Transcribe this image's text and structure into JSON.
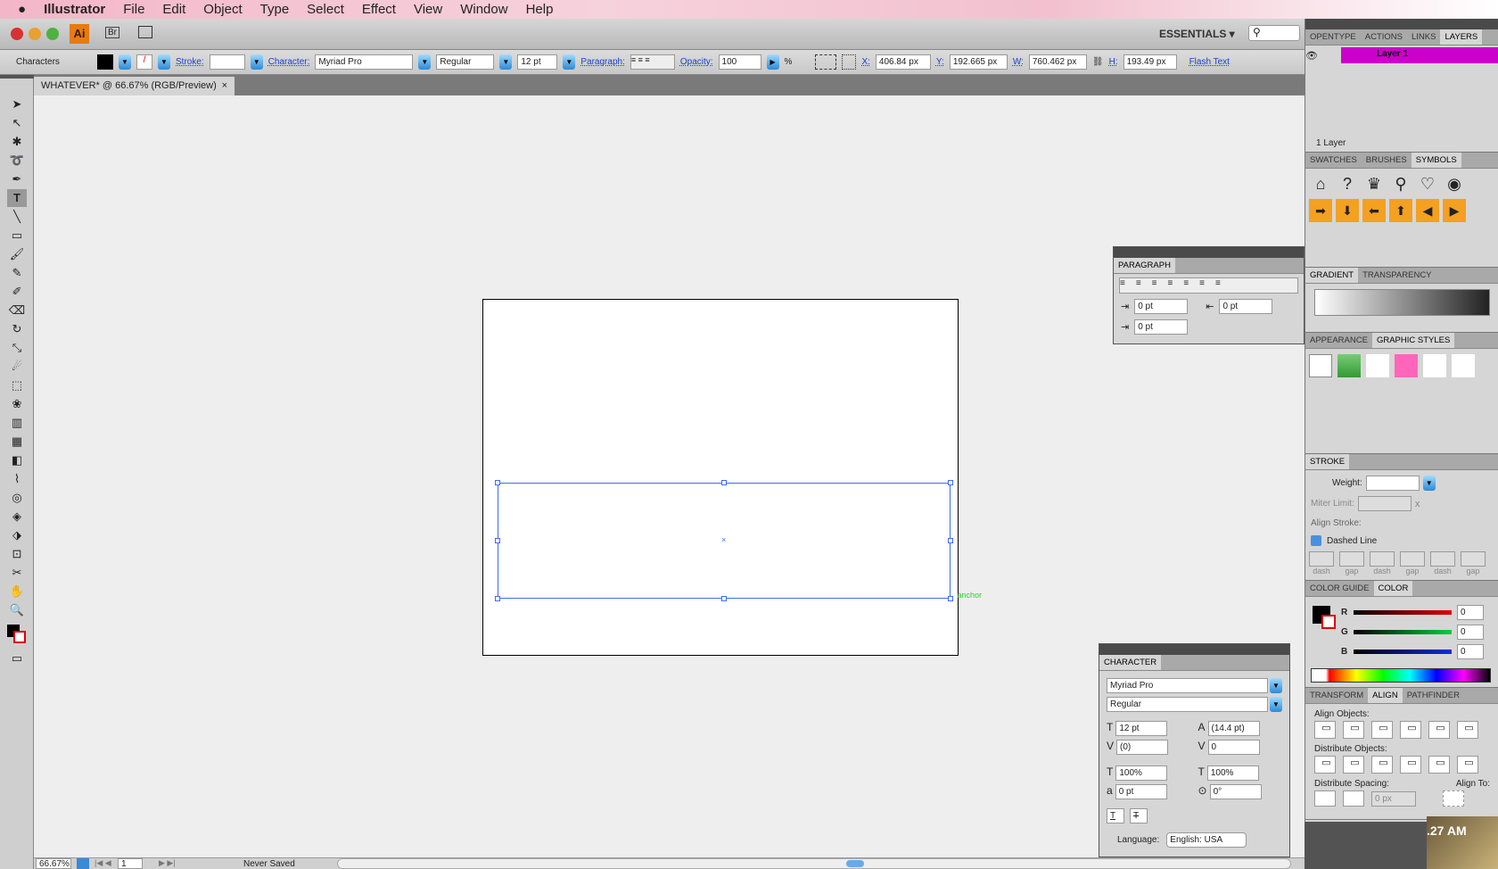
{
  "menubar": {
    "app": "Illustrator",
    "items": [
      "File",
      "Edit",
      "Object",
      "Type",
      "Select",
      "Effect",
      "View",
      "Window",
      "Help"
    ]
  },
  "appbar": {
    "logo": "Ai",
    "bridge": "Br",
    "workspace": "ESSENTIALS ▾"
  },
  "control": {
    "mode": "Characters",
    "stroke_label": "Stroke:",
    "character_label": "Character:",
    "font": "Myriad Pro",
    "style": "Regular",
    "size": "12 pt",
    "paragraph_label": "Paragraph:",
    "opacity_label": "Opacity:",
    "opacity": "100",
    "pct": "%",
    "x_label": "X:",
    "x": "406.84 px",
    "y_label": "Y:",
    "y": "192.665 px",
    "w_label": "W:",
    "w": "760.462 px",
    "h_label": "H:",
    "h": "193.49 px",
    "flash": "Flash Text"
  },
  "document": {
    "tab": "WHATEVER* @ 66.67% (RGB/Preview)",
    "close": "×",
    "anchor_hint": "anchor"
  },
  "status": {
    "zoom": "66.67%",
    "page": "1",
    "saved": "Never Saved"
  },
  "layers": {
    "tabs": [
      "OPENTYPE",
      "ACTIONS",
      "LINKS",
      "LAYERS"
    ],
    "layer": "Layer 1",
    "count": "1 Layer",
    "layer_color": "#cc00cc"
  },
  "symbols": {
    "tabs": [
      "SWATCHES",
      "BRUSHES",
      "SYMBOLS"
    ],
    "items": [
      "⌂",
      "?",
      "♛",
      "⚲",
      "♡",
      "◉",
      "➡",
      "⬇",
      "⬅",
      "⬆",
      "◀",
      "▶"
    ]
  },
  "gradient": {
    "tabs": [
      "GRADIENT",
      "TRANSPARENCY"
    ]
  },
  "styles": {
    "tabs": [
      "APPEARANCE",
      "GRAPHIC STYLES"
    ]
  },
  "stroke": {
    "title": "STROKE",
    "weight": "Weight:",
    "miter": "Miter Limit:",
    "x": "x",
    "align": "Align Stroke:",
    "dashed": "Dashed Line",
    "dash_labels": [
      "dash",
      "gap",
      "dash",
      "gap",
      "dash",
      "gap"
    ]
  },
  "color": {
    "tabs": [
      "COLOR GUIDE",
      "COLOR"
    ],
    "channels": [
      {
        "k": "R",
        "v": "0",
        "c": "#e00000"
      },
      {
        "k": "G",
        "v": "0",
        "c": "#00d040"
      },
      {
        "k": "B",
        "v": "0",
        "c": "#0030e0"
      }
    ]
  },
  "align": {
    "tabs": [
      "TRANSFORM",
      "ALIGN",
      "PATHFINDER"
    ],
    "objects": "Align Objects:",
    "distribute": "Distribute Objects:",
    "spacing": "Distribute Spacing:",
    "align_to": "Align To:",
    "spacing_val": "0 px"
  },
  "paragraph": {
    "title": "PARAGRAPH",
    "left_indent": "0 pt",
    "right_indent": "0 pt",
    "first_indent": "0 pt"
  },
  "character": {
    "title": "CHARACTER",
    "font": "Myriad Pro",
    "style": "Regular",
    "size": "12 pt",
    "leading": "(14.4 pt)",
    "kerning": "(0)",
    "tracking": "0",
    "hscale": "100%",
    "vscale": "100%",
    "baseline": "0 pt",
    "rotation": "0°",
    "language_label": "Language:",
    "language": "English: USA"
  },
  "desktop": {
    "clock": ".27 AM"
  }
}
